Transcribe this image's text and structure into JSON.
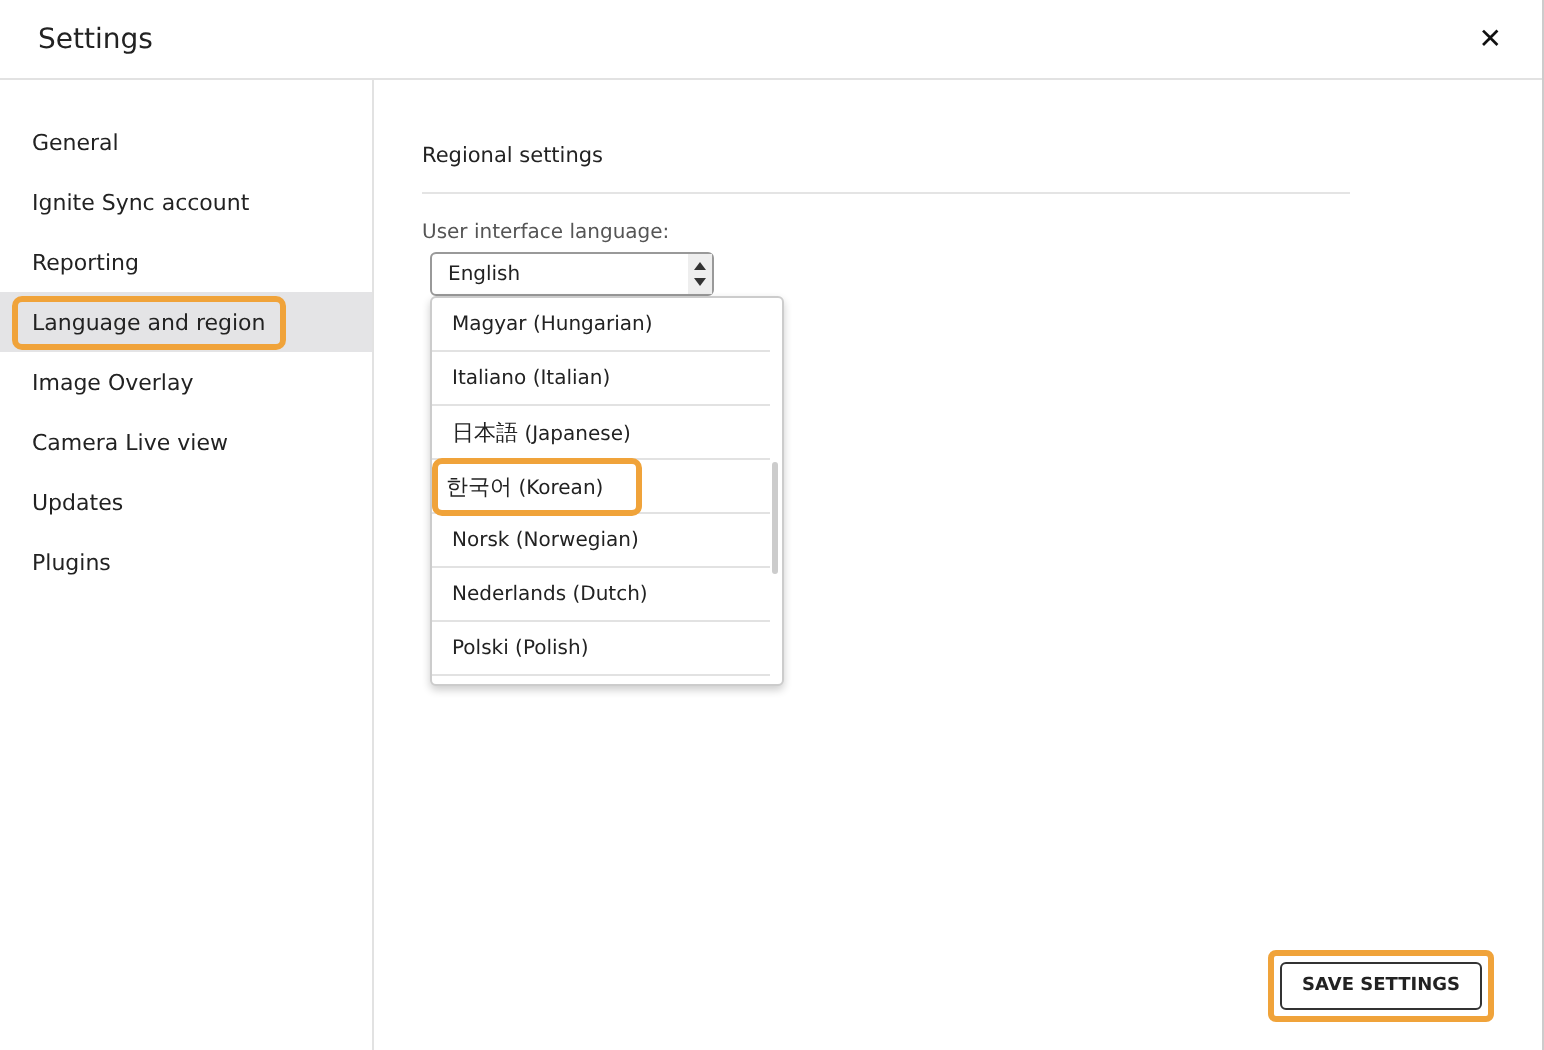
{
  "window": {
    "title": "Settings",
    "close": "✕"
  },
  "sidebar": {
    "items": [
      {
        "label": "General",
        "selected": false,
        "highlighted": false
      },
      {
        "label": "Ignite Sync account",
        "selected": false,
        "highlighted": false
      },
      {
        "label": "Reporting",
        "selected": false,
        "highlighted": false
      },
      {
        "label": "Language and region",
        "selected": true,
        "highlighted": true
      },
      {
        "label": "Image Overlay",
        "selected": false,
        "highlighted": false
      },
      {
        "label": "Camera Live view",
        "selected": false,
        "highlighted": false
      },
      {
        "label": "Updates",
        "selected": false,
        "highlighted": false
      },
      {
        "label": "Plugins",
        "selected": false,
        "highlighted": false
      }
    ]
  },
  "section": {
    "title": "Regional settings",
    "language_label": "User interface language:",
    "language_value": "English",
    "options": [
      {
        "native": "Magyar",
        "english": "(Hungarian)",
        "highlighted": false
      },
      {
        "native": "Italiano",
        "english": "(Italian)",
        "highlighted": false
      },
      {
        "native": "日本語",
        "english": "(Japanese)",
        "highlighted": false
      },
      {
        "native": "한국어",
        "english": "(Korean)",
        "highlighted": true
      },
      {
        "native": "Norsk",
        "english": "(Norwegian)",
        "highlighted": false
      },
      {
        "native": "Nederlands",
        "english": "(Dutch)",
        "highlighted": false
      },
      {
        "native": "Polski",
        "english": "(Polish)",
        "highlighted": false
      }
    ]
  },
  "save_button": {
    "label": "SAVE SETTINGS",
    "highlighted": true
  }
}
